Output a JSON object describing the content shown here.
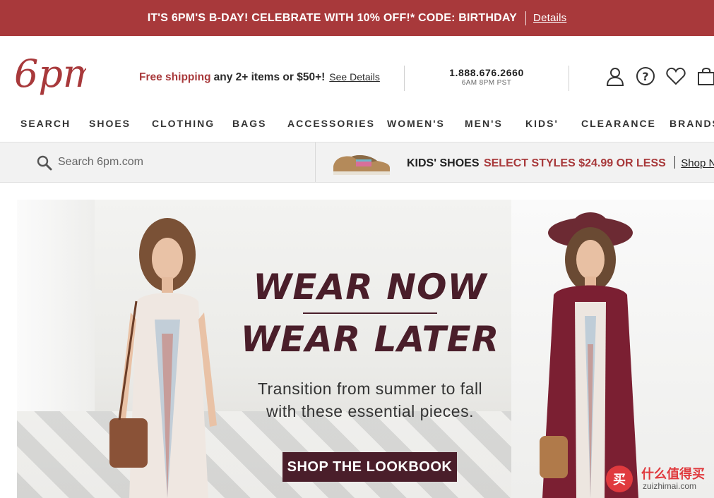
{
  "promo": {
    "text": "IT'S 6PM'S B-DAY! CELEBRATE WITH 10% OFF!* CODE: BIRTHDAY",
    "link": "Details"
  },
  "header": {
    "logo_text": "6pm",
    "shipping_highlight": "Free shipping",
    "shipping_rest": "any 2+ items or $50+!",
    "shipping_link": "See Details",
    "phone": "1.888.676.2660",
    "hours": "6AM   8PM PST",
    "icons": [
      "account-icon",
      "help-icon",
      "favorites-heart-icon",
      "shopping-bag-icon"
    ]
  },
  "nav": {
    "items": [
      "SEARCH",
      "SHOES",
      "CLOTHING",
      "BAGS",
      "ACCESSORIES",
      "WOMEN'S",
      "MEN'S",
      "KIDS'",
      "CLEARANCE",
      "BRANDS"
    ]
  },
  "search": {
    "placeholder": "Search 6pm.com"
  },
  "kids_banner": {
    "label": "KIDS' SHOES",
    "offer": "SELECT STYLES $24.99 OR LESS",
    "link": "Shop Now"
  },
  "hero": {
    "line1": "WEAR NOW",
    "line2": "WEAR LATER",
    "sub1": "Transition from summer to fall",
    "sub2": "with these essential pieces.",
    "cta": "SHOP THE LOOKBOOK"
  },
  "watermark": {
    "badge": "买",
    "cn": "什么值得买",
    "url": "zuizhimai.com"
  },
  "colors": {
    "brand_red": "#a8393b",
    "hero_plum": "#4a1e2a"
  }
}
